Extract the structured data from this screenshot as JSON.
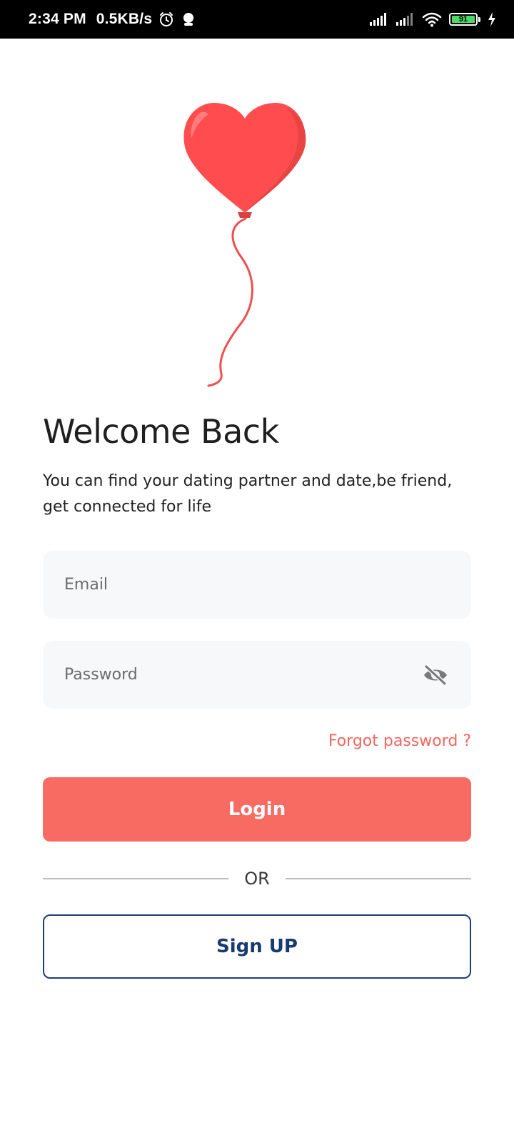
{
  "status_bar": {
    "time": "2:34 PM",
    "net_speed": "0.5KB/s",
    "battery_level": "91",
    "icons": [
      "alarm-icon",
      "notification-icon",
      "signal-icon",
      "signal-icon",
      "wifi-icon",
      "battery-icon",
      "charging-icon"
    ]
  },
  "welcome": {
    "illustration": "heart-balloon",
    "title": "Welcome Back",
    "subtitle": "You can find your dating partner and date,be friend, get connected for life"
  },
  "form": {
    "email_placeholder": "Email",
    "password_placeholder": "Password",
    "password_toggle_icon": "eye-off-icon",
    "forgot_password": "Forgot password ?",
    "login_label": "Login",
    "or_label": "OR",
    "signup_label": "Sign UP"
  },
  "colors": {
    "primary": "#f76b62",
    "link": "#f0675e",
    "secondary": "#1b3f7a",
    "field_bg": "#f7f8fa",
    "heart": "#ff4f4f"
  }
}
